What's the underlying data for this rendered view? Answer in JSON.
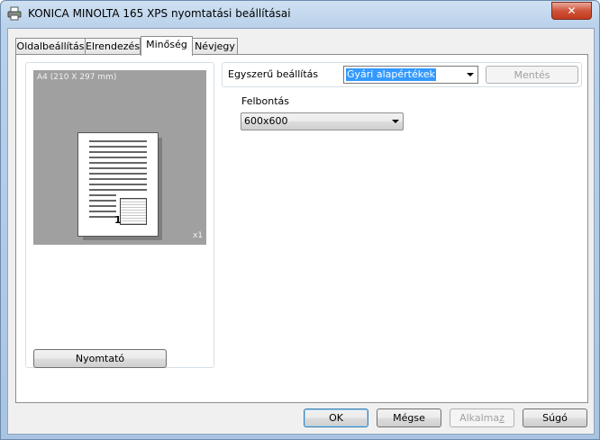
{
  "window": {
    "title": "KONICA MINOLTA 165 XPS nyomtatási beállításai",
    "close_glyph": "✕",
    "icon": "printer-icon"
  },
  "tabs": [
    {
      "label": "Oldalbeállítás",
      "active": false
    },
    {
      "label": "Elrendezés",
      "active": false
    },
    {
      "label": "Minőség",
      "active": true
    },
    {
      "label": "Névjegy",
      "active": false
    }
  ],
  "preview": {
    "paper_label": "A4 (210 X 297 mm)",
    "copies_label": "x1",
    "page_number": "1",
    "printer_button": "Nyomtató"
  },
  "quick_settings": {
    "label": "Egyszerű beállítás",
    "value": "Gyári alapértékek",
    "save_button": "Mentés"
  },
  "resolution": {
    "label": "Felbontás",
    "value": "600x600"
  },
  "footer": {
    "ok": "OK",
    "cancel": "Mégse",
    "apply_pre": "Alkalma",
    "apply_access": "z",
    "help": "Súgó"
  },
  "colors": {
    "accent_selection": "#3399ff",
    "preview_bg": "#a0a0a0"
  }
}
